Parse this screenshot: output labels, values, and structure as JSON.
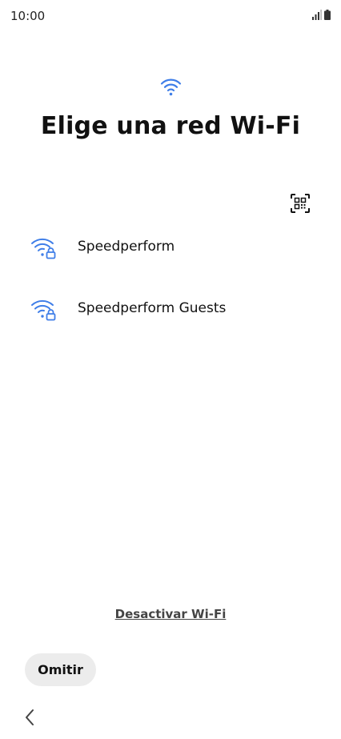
{
  "status_bar": {
    "time": "10:00",
    "icons": [
      "signal-icon",
      "battery-icon"
    ]
  },
  "header": {
    "icon": "wifi-icon",
    "title": "Elige una red Wi-Fi"
  },
  "qr_button": {
    "icon": "qr-code-scan-icon"
  },
  "networks": [
    {
      "name": "Speedperform",
      "icon": "wifi-lock-icon"
    },
    {
      "name": "Speedperform Guests",
      "icon": "wifi-lock-icon"
    }
  ],
  "footer": {
    "disable_wifi_label": "Desactivar Wi-Fi",
    "skip_label": "Omitir",
    "back_icon": "back-chevron-icon"
  },
  "colors": {
    "accent": "#3f7ee8",
    "background": "#ffffff",
    "skip_button_bg": "#ececec"
  }
}
